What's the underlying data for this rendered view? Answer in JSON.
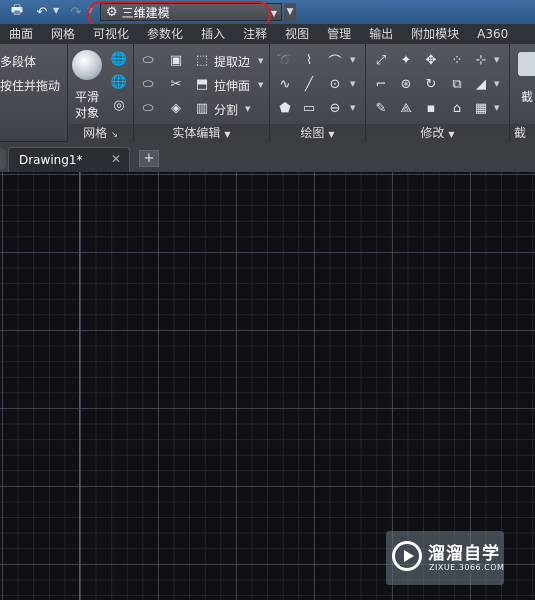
{
  "workspace": {
    "label": "三维建模"
  },
  "tabs": [
    "曲面",
    "网格",
    "可视化",
    "参数化",
    "插入",
    "注释",
    "视图",
    "管理",
    "输出",
    "附加模块",
    "A360"
  ],
  "ribbon": {
    "modeling_partial": {
      "polysolid": "多段体",
      "presspull": "按住并拖动"
    },
    "mesh_panel": {
      "title": "网格",
      "smooth_line1": "平滑",
      "smooth_line2": "对象"
    },
    "solid_editing_panel": {
      "title": "实体编辑",
      "extract_edges": "提取边",
      "extrude_faces": "拉伸面",
      "separate": "分割"
    },
    "draw_panel": {
      "title": "绘图"
    },
    "modify_panel": {
      "title": "修改"
    },
    "section_panel_partial": {
      "title": "截面",
      "label_partial": "截"
    }
  },
  "file_tabs": {
    "drawing": "Drawing1*",
    "close_glyph": "✕",
    "new_glyph": "+"
  },
  "watermark": {
    "title": "溜溜自学",
    "subtitle": "ZIXUE.3066.COM"
  },
  "colors": {
    "accent_highlight": "#e21b1b",
    "y_axis": "#2c7a36",
    "canvas": "#0e1014"
  }
}
